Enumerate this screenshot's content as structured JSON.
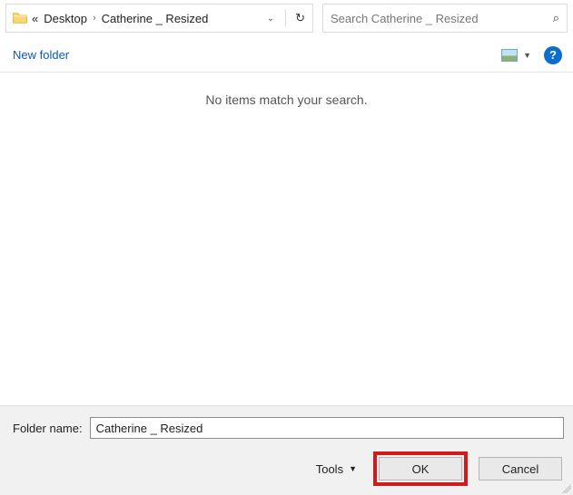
{
  "breadcrumb": {
    "prefix": "«",
    "items": [
      "Desktop",
      "Catherine _ Resized"
    ]
  },
  "search": {
    "placeholder": "Search Catherine _ Resized"
  },
  "commands": {
    "new_folder": "New folder",
    "help": "?"
  },
  "content": {
    "empty_message": "No items match your search."
  },
  "footer": {
    "folder_name_label": "Folder name:",
    "folder_name_value": "Catherine _ Resized",
    "tools_label": "Tools",
    "ok_label": "OK",
    "cancel_label": "Cancel"
  }
}
